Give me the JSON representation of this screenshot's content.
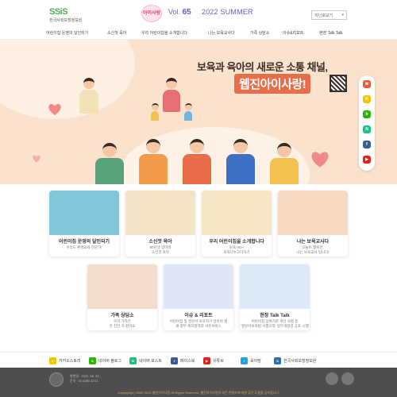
{
  "header": {
    "logo_text": "SSiS",
    "org_name": "한국사회보장정보원",
    "brand_name": "아이사랑",
    "vol_label": "Vol.",
    "vol_number": "65",
    "season": "2022 SUMMER",
    "search_select": "지난호보기"
  },
  "nav": [
    "어린이집 운영의 달인되기",
    "소신껏 육아",
    "우리 어린이집을 소개합니다",
    "나는 보육교사다",
    "가족 상담소",
    "이슈&리포트",
    "현장 Talk Talk"
  ],
  "hero": {
    "title_line1": "보육과 육아의 새로운 소통 채널,",
    "title_line2": "웹진아이사랑!"
  },
  "social": [
    {
      "name": "email",
      "color": "#f1583b",
      "glyph": "✉"
    },
    {
      "name": "kakaostory",
      "color": "#f7c500",
      "glyph": "K"
    },
    {
      "name": "naver-blog",
      "color": "#2db400",
      "glyph": "b"
    },
    {
      "name": "naver-post",
      "color": "#19c37d",
      "glyph": "N"
    },
    {
      "name": "facebook",
      "color": "#3b5998",
      "glyph": "f"
    },
    {
      "name": "youtube",
      "color": "#e62117",
      "glyph": "▶"
    }
  ],
  "cards": [
    {
      "title": "어린이집 운영의 달인되기",
      "sub1": "우리도 환경교육 전문가!",
      "sub2": "",
      "color": "#7fc7d9"
    },
    {
      "title": "소신껏 육아",
      "sub1": "90년생 엄마의",
      "sub2": "소신껏 육아",
      "color": "#f3e4c8"
    },
    {
      "title": "우리 어린이집을 소개합니다",
      "sub1": "보육+50+",
      "sub2": "보육나누고더하기",
      "color": "#f6e6c4"
    },
    {
      "title": "나는 보육교사다",
      "sub1": "오늘이 행복한,",
      "sub2": "나는 보육교사 입니다!",
      "color": "#f9d9c4"
    },
    {
      "title": "가족 상담소",
      "sub1": "우리 가족은",
      "sub2": "안 친한 거 같아요",
      "color": "#f2ddd0"
    },
    {
      "title": "이슈 & 리포트",
      "sub1": "어린이집 및 영유아 보호자가 알아야 할",
      "sub2": "새 정부 복지정책과 사유서비스",
      "color": "#dfe6f5"
    },
    {
      "title": "현장 Talk Talk",
      "sub1": "어린이집 상위기준 개선 사항 등",
      "sub2": "'영유아보육법 시행규칙' 일부개정령 공포·시행",
      "color": "#dceaf7"
    }
  ],
  "links": [
    {
      "label": "카카오스토리",
      "color": "#f7c500",
      "glyph": "K"
    },
    {
      "label": "네이버 블로그",
      "color": "#2db400",
      "glyph": "b"
    },
    {
      "label": "네이버 포스트",
      "color": "#19c37d",
      "glyph": "N"
    },
    {
      "label": "페이스북",
      "color": "#3b5998",
      "glyph": "f"
    },
    {
      "label": "유튜브",
      "color": "#e62117",
      "glyph": "▶"
    },
    {
      "label": "육아맘",
      "color": "#1fa3e0",
      "glyph": "i"
    },
    {
      "label": "한국사회보장정보원",
      "color": "#2a6fb5",
      "glyph": "S"
    }
  ],
  "footer": {
    "info_line1": "발행일 : 2022. 06. 30.",
    "info_line2": "문의 : 02-6360-6741",
    "copyright": "Copyright(c) 2006~2022 웹진아이사랑 All Rights Reserved. 웹진아이사랑의 모든 콘텐츠에 대한 무단 도용을 금지합니다."
  }
}
